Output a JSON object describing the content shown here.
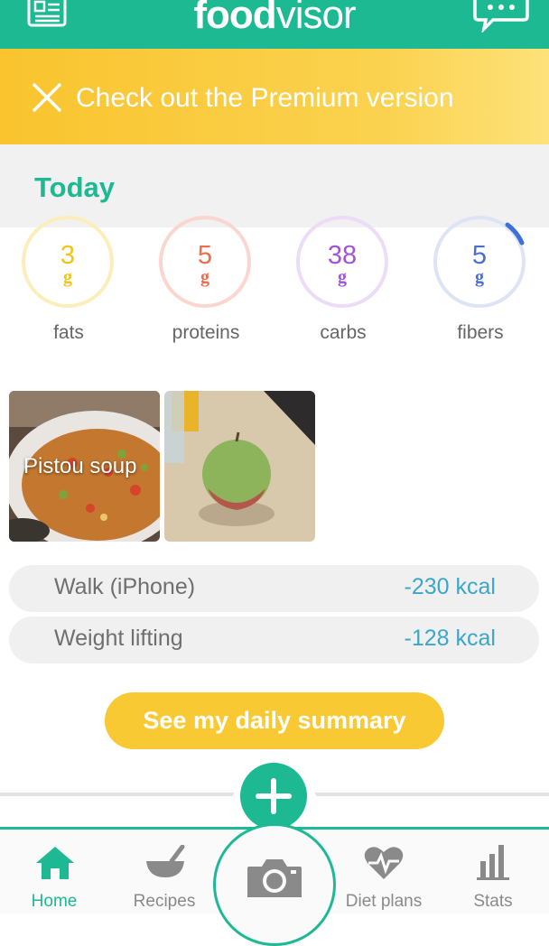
{
  "header": {
    "logo_bold": "food",
    "logo_light": "visor",
    "news_icon": "newspaper-icon",
    "chat_icon": "chat-icon"
  },
  "premium": {
    "close_icon": "close-icon",
    "text": "Check out the Premium version"
  },
  "today": {
    "label": "Today"
  },
  "macros": [
    {
      "value": "3",
      "unit": "g",
      "label": "fats",
      "color": "#f0c419",
      "ring": "#fbeeba"
    },
    {
      "value": "5",
      "unit": "g",
      "label": "proteins",
      "color": "#ef6b4a",
      "ring": "#fbd6cf"
    },
    {
      "value": "38",
      "unit": "g",
      "label": "carbs",
      "color": "#a055d6",
      "ring": "#ecdcf8"
    },
    {
      "value": "5",
      "unit": "g",
      "label": "fibers",
      "color": "#4a6fd0",
      "ring": "#dde4f6"
    }
  ],
  "photos": [
    {
      "label": "Pistou soup"
    },
    {
      "label": ""
    }
  ],
  "activities": [
    {
      "name": "Walk (iPhone)",
      "kcal": "-230 kcal"
    },
    {
      "name": "Weight lifting",
      "kcal": "-128 kcal"
    }
  ],
  "summary_button": "See my daily summary",
  "tabs": [
    {
      "label": "Home",
      "icon": "home-icon",
      "active": true
    },
    {
      "label": "Recipes",
      "icon": "bowl-icon",
      "active": false
    },
    {
      "label": "",
      "icon": "camera-icon",
      "active": false
    },
    {
      "label": "Diet plans",
      "icon": "heart-pulse-icon",
      "active": false
    },
    {
      "label": "Stats",
      "icon": "bar-chart-icon",
      "active": false
    }
  ],
  "colors": {
    "brand": "#1db992",
    "premium": "#f9c42e",
    "activity_kcal": "#3aa7c9"
  }
}
